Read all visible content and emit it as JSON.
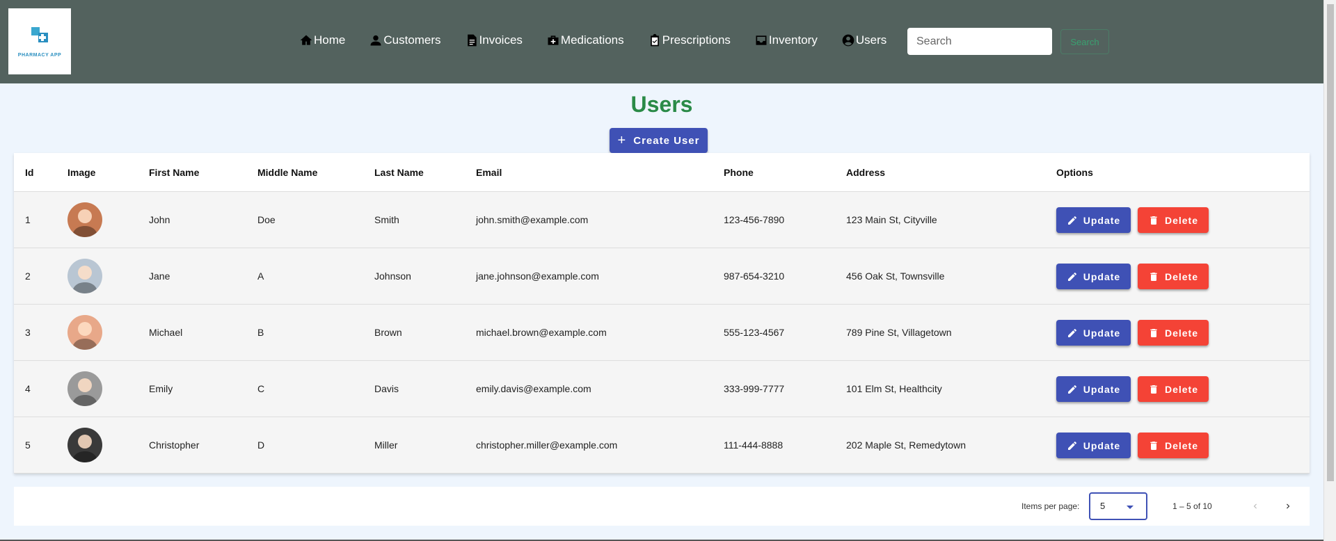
{
  "header": {
    "logo_text": "PHARMACY APP",
    "nav": [
      {
        "label": "Home",
        "icon": "home-icon"
      },
      {
        "label": "Customers",
        "icon": "person-icon"
      },
      {
        "label": "Invoices",
        "icon": "document-icon"
      },
      {
        "label": "Medications",
        "icon": "medical-kit-icon"
      },
      {
        "label": "Prescriptions",
        "icon": "clipboard-check-icon"
      },
      {
        "label": "Inventory",
        "icon": "inbox-icon"
      },
      {
        "label": "Users",
        "icon": "account-circle-icon"
      }
    ],
    "search_placeholder": "Search",
    "search_button": "Search"
  },
  "page": {
    "title": "Users",
    "create_button": "Create User"
  },
  "table": {
    "columns": [
      "Id",
      "Image",
      "First Name",
      "Middle Name",
      "Last Name",
      "Email",
      "Phone",
      "Address",
      "Options"
    ],
    "rows": [
      {
        "id": "1",
        "first": "John",
        "middle": "Doe",
        "last": "Smith",
        "email": "john.smith@example.com",
        "phone": "123-456-7890",
        "address": "123 Main St, Cityville",
        "avatar_color": "#c77a52"
      },
      {
        "id": "2",
        "first": "Jane",
        "middle": "A",
        "last": "Johnson",
        "email": "jane.johnson@example.com",
        "phone": "987-654-3210",
        "address": "456 Oak St, Townsville",
        "avatar_color": "#b9c6d3"
      },
      {
        "id": "3",
        "first": "Michael",
        "middle": "B",
        "last": "Brown",
        "email": "michael.brown@example.com",
        "phone": "555-123-4567",
        "address": "789 Pine St, Villagetown",
        "avatar_color": "#e8a889"
      },
      {
        "id": "4",
        "first": "Emily",
        "middle": "C",
        "last": "Davis",
        "email": "emily.davis@example.com",
        "phone": "333-999-7777",
        "address": "101 Elm St, Healthcity",
        "avatar_color": "#9a9a9a"
      },
      {
        "id": "5",
        "first": "Christopher",
        "middle": "D",
        "last": "Miller",
        "email": "christopher.miller@example.com",
        "phone": "111-444-8888",
        "address": "202 Maple St, Remedytown",
        "avatar_color": "#3a3a3a"
      }
    ],
    "update_label": "Update",
    "delete_label": "Delete"
  },
  "paginator": {
    "items_per_page_label": "Items per page:",
    "items_per_page_value": "5",
    "range_label": "1 – 5 of 10"
  },
  "colors": {
    "header_bg": "#53625e",
    "title_green": "#2a8a47",
    "primary": "#3f51b5",
    "danger": "#f44336",
    "page_bg": "#eef5fd"
  }
}
